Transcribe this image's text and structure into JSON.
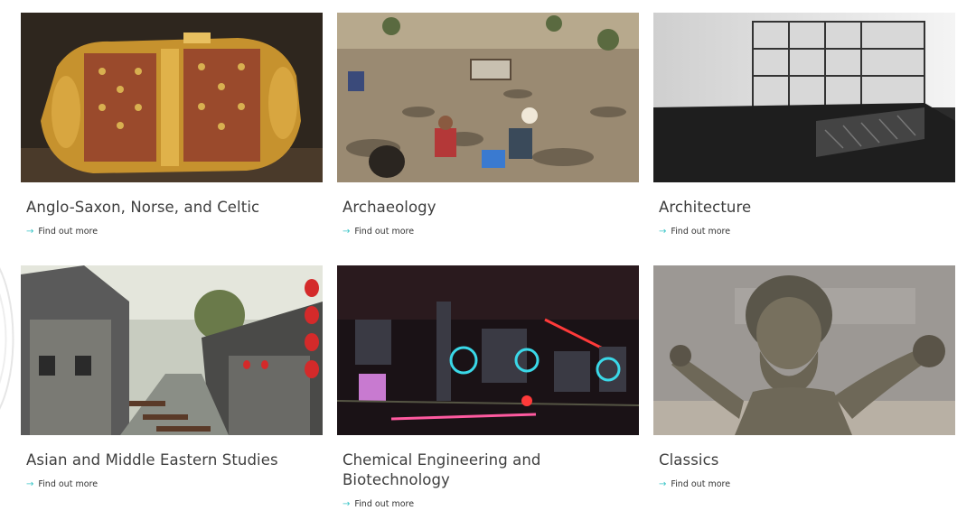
{
  "cards": [
    {
      "title": "Anglo-Saxon, Norse, and Celtic",
      "link": "Find out more",
      "image": "gold-jewelled-buckle"
    },
    {
      "title": "Archaeology",
      "link": "Find out more",
      "image": "excavation-site"
    },
    {
      "title": "Architecture",
      "link": "Find out more",
      "image": "architectural-model"
    },
    {
      "title": "Asian and Middle Eastern Studies",
      "link": "Find out more",
      "image": "canal-town-with-lanterns"
    },
    {
      "title": "Chemical Engineering and Biotechnology",
      "link": "Find out more",
      "image": "laser-optics-lab"
    },
    {
      "title": "Classics",
      "link": "Find out more",
      "image": "bronze-statue"
    }
  ],
  "colors": {
    "title": "#3e3e3e",
    "link_text": "#333333",
    "arrow": "#3cc6c8"
  },
  "icons": {
    "link_arrow": "arrow-right-icon"
  }
}
